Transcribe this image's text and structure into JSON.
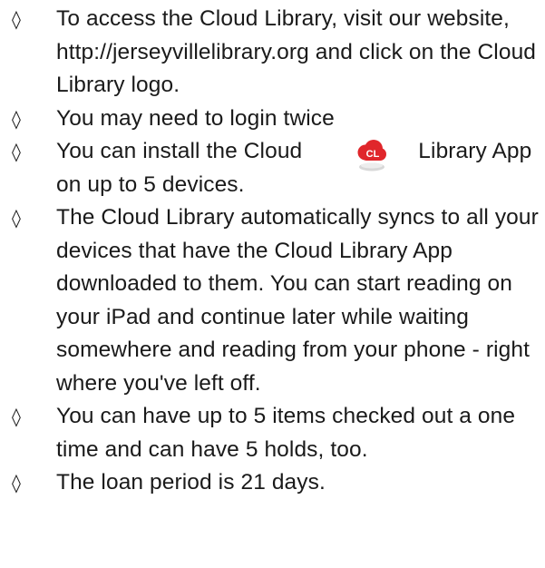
{
  "bullet_symbol": "◊",
  "items": [
    {
      "text": "To access the Cloud Library, visit our website, http://jerseyvillelibrary.org and click on the Cloud Library logo."
    },
    {
      "text": "You may need to login twice"
    },
    {
      "text_before": "You can install the Cloud",
      "text_after": "Library App on up to 5 devices.",
      "logo_text": "CL"
    },
    {
      "text": "The Cloud Library automatically syncs to all your devices that have the Cloud Library App downloaded to them. You can start reading on your iPad and continue later while waiting somewhere and reading from your phone - right where you've left off."
    },
    {
      "text": "You can have up to 5 items checked out a one time and can have 5 holds, too."
    },
    {
      "text": "The loan period is 21 days."
    }
  ],
  "colors": {
    "text": "#1a1a1a",
    "logo_red": "#e0262b",
    "logo_base": "#d8d8d8"
  }
}
